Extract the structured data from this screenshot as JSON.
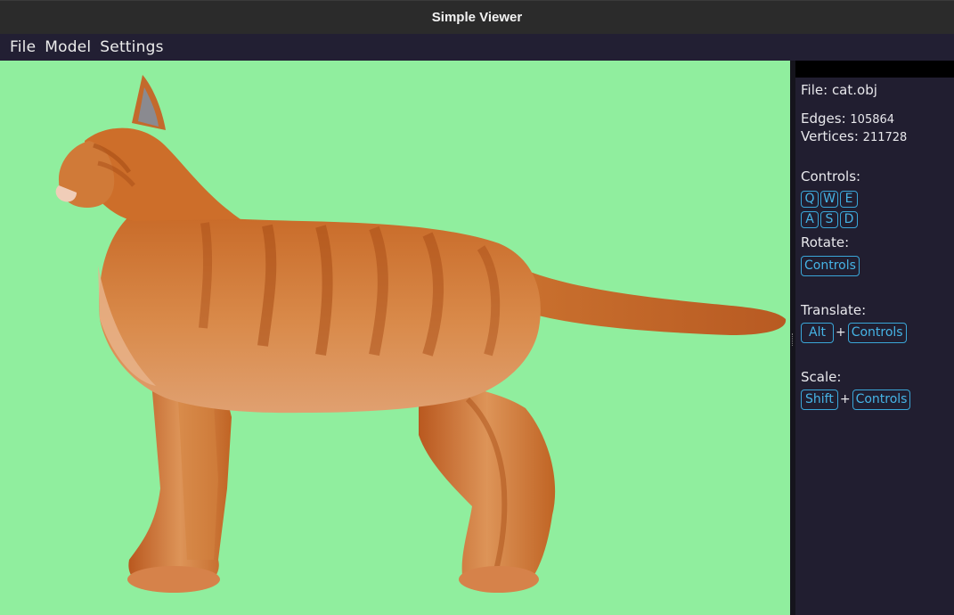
{
  "window": {
    "title": "Simple Viewer"
  },
  "menu": {
    "items": [
      "File",
      "Model",
      "Settings"
    ]
  },
  "viewport": {
    "background": "#90ee9e",
    "model_color": "#c8621f"
  },
  "info": {
    "file_label": "File:",
    "file_value": "cat.obj",
    "edges_label": "Edges:",
    "edges_value": "105864",
    "vertices_label": "Vertices:",
    "vertices_value": "211728"
  },
  "controls": {
    "heading": "Controls:",
    "row1": [
      "Q",
      "W",
      "E"
    ],
    "row2": [
      "A",
      "S",
      "D"
    ],
    "rotate_label": "Rotate:",
    "rotate_key": "Controls",
    "translate_label": "Translate:",
    "translate_modifier": "Alt",
    "translate_key": "Controls",
    "scale_label": "Scale:",
    "scale_modifier": "Shift",
    "scale_key": "Controls",
    "plus": "+"
  },
  "colors": {
    "accent": "#3aa6d8",
    "panel_bg": "#211e30",
    "menubar_bg": "#221f33"
  }
}
